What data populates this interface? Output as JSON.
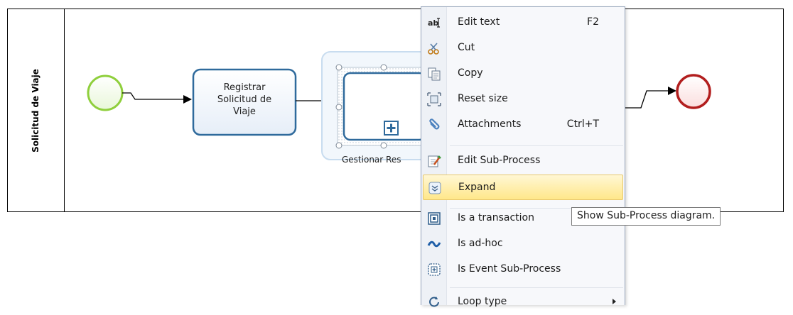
{
  "pool": {
    "title": "Solicitud de Viaje"
  },
  "task": {
    "lines": [
      "Registrar",
      "Solicitud de",
      "Viaje"
    ]
  },
  "subprocess": {
    "label_visible": "Gestionar Res"
  },
  "context_menu": {
    "items": [
      {
        "label": "Edit text",
        "shortcut": "F2",
        "icon": "edit-text-icon"
      },
      {
        "label": "Cut",
        "shortcut": "",
        "icon": "scissors-icon"
      },
      {
        "label": "Copy",
        "shortcut": "",
        "icon": "copy-icon"
      },
      {
        "label": "Reset size",
        "shortcut": "",
        "icon": "reset-size-icon"
      },
      {
        "label": "Attachments",
        "shortcut": "Ctrl+T",
        "icon": "paperclip-icon"
      },
      {
        "label": "Edit Sub-Process",
        "shortcut": "",
        "icon": "edit-subprocess-icon"
      },
      {
        "label": "Expand",
        "shortcut": "",
        "icon": "expand-icon",
        "highlighted": true
      },
      {
        "label": "Is a transaction",
        "shortcut": "",
        "icon": "transaction-icon"
      },
      {
        "label": "Is ad-hoc",
        "shortcut": "",
        "icon": "adhoc-icon"
      },
      {
        "label": "Is Event Sub-Process",
        "shortcut": "",
        "icon": "event-subprocess-icon"
      },
      {
        "label": "Loop type",
        "shortcut": "",
        "icon": "loop-icon",
        "submenu": true
      }
    ]
  },
  "tooltip": {
    "text": "Show Sub-Process diagram."
  },
  "colors": {
    "start_event": "#8fcf3c",
    "end_event": "#b21e1e",
    "task_border": "#2f6a9c",
    "highlight": "#ffe78a"
  }
}
